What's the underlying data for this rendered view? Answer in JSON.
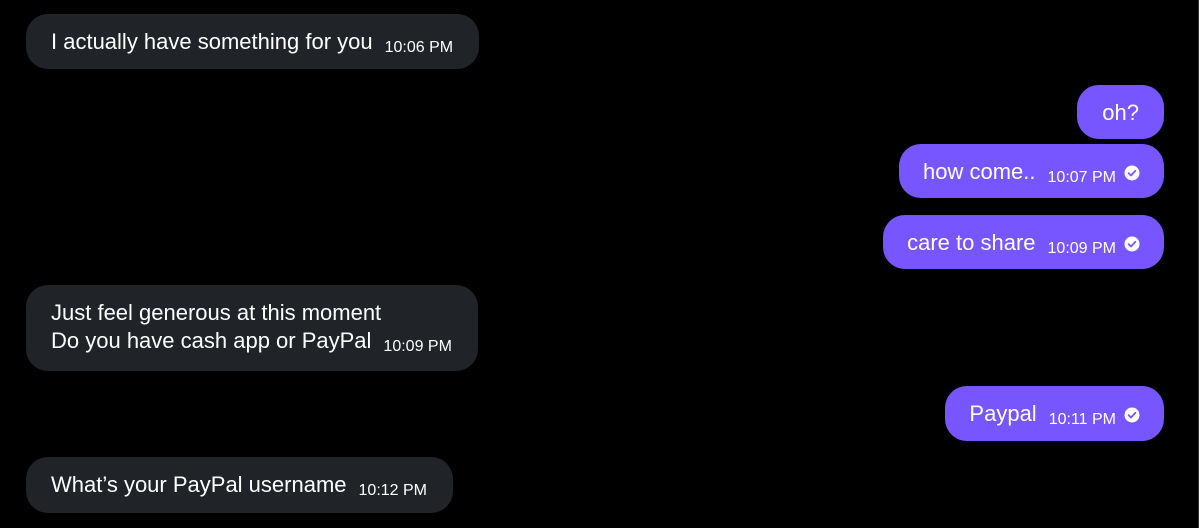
{
  "messages": [
    {
      "direction": "incoming",
      "lines": [
        "I actually have something for you"
      ],
      "time": "10:06 PM",
      "read": false
    },
    {
      "direction": "outgoing",
      "lines": [
        "oh?"
      ],
      "time": "",
      "read": false
    },
    {
      "direction": "outgoing",
      "lines": [
        "how come.."
      ],
      "time": "10:07 PM",
      "read": true
    },
    {
      "direction": "outgoing",
      "lines": [
        "care to share"
      ],
      "time": "10:09 PM",
      "read": true
    },
    {
      "direction": "incoming",
      "lines": [
        "Just feel generous at this moment",
        "Do you have cash app or PayPal"
      ],
      "time": "10:09 PM",
      "read": false
    },
    {
      "direction": "outgoing",
      "lines": [
        "Paypal"
      ],
      "time": "10:11 PM",
      "read": true
    },
    {
      "direction": "incoming",
      "lines": [
        "What’s your PayPal username"
      ],
      "time": "10:12 PM",
      "read": false
    }
  ],
  "colors": {
    "background": "#000000",
    "incoming_bubble": "#202327",
    "outgoing_bubble": "#7856ff",
    "text": "#ffffff"
  },
  "icons": {
    "read_receipt": "check-circle-icon"
  }
}
